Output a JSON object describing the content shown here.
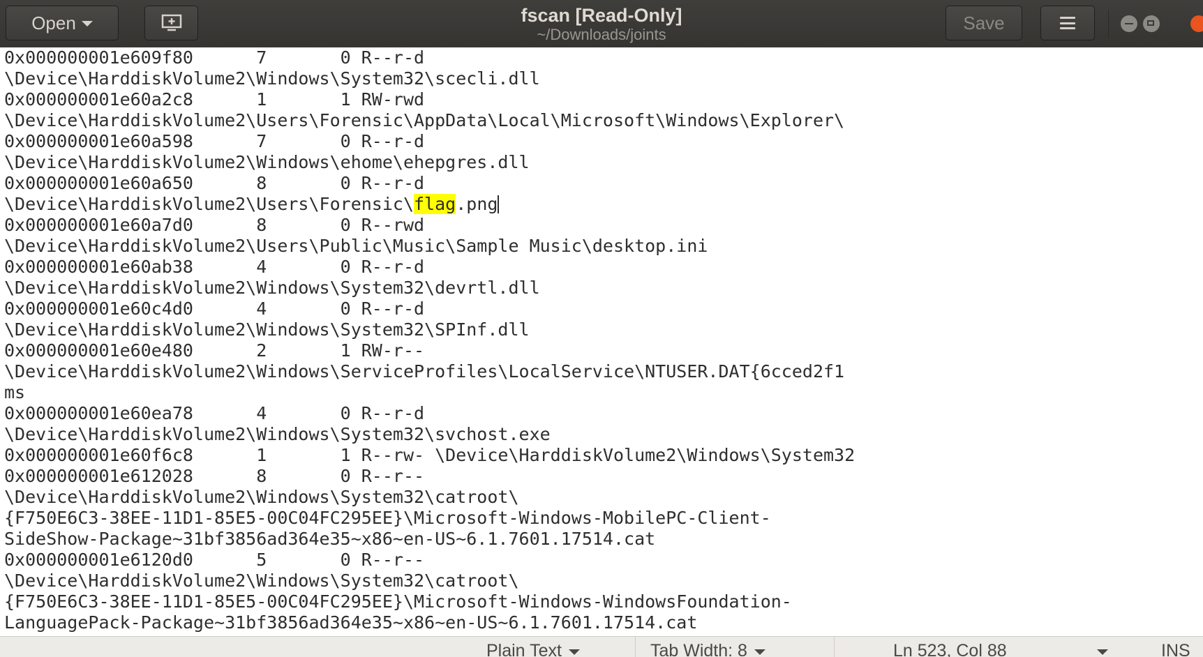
{
  "window": {
    "title": "fscan [Read-Only]",
    "subtitle": "~/Downloads/joints",
    "open_label": "Open",
    "save_label": "Save"
  },
  "editor": {
    "lines_before": [
      "0x000000001e609f80      7       0 R--r-d",
      "\\Device\\HarddiskVolume2\\Windows\\System32\\scecli.dll",
      "0x000000001e60a2c8      1       1 RW-rwd",
      "\\Device\\HarddiskVolume2\\Users\\Forensic\\AppData\\Local\\Microsoft\\Windows\\Explorer\\",
      "0x000000001e60a598      7       0 R--r-d",
      "\\Device\\HarddiskVolume2\\Windows\\ehome\\ehepgres.dll",
      "0x000000001e60a650      8       0 R--r-d"
    ],
    "match_line": {
      "prefix": "\\Device\\HarddiskVolume2\\Users\\Forensic\\",
      "match": "flag",
      "suffix": ".png"
    },
    "lines_after": [
      "0x000000001e60a7d0      8       0 R--rwd",
      "\\Device\\HarddiskVolume2\\Users\\Public\\Music\\Sample Music\\desktop.ini",
      "0x000000001e60ab38      4       0 R--r-d",
      "\\Device\\HarddiskVolume2\\Windows\\System32\\devrtl.dll",
      "0x000000001e60c4d0      4       0 R--r-d",
      "\\Device\\HarddiskVolume2\\Windows\\System32\\SPInf.dll",
      "0x000000001e60e480      2       1 RW-r--",
      "\\Device\\HarddiskVolume2\\Windows\\ServiceProfiles\\LocalService\\NTUSER.DAT{6cced2f1",
      "ms",
      "0x000000001e60ea78      4       0 R--r-d",
      "\\Device\\HarddiskVolume2\\Windows\\System32\\svchost.exe",
      "0x000000001e60f6c8      1       1 R--rw- \\Device\\HarddiskVolume2\\Windows\\System32",
      "0x000000001e612028      8       0 R--r--",
      "\\Device\\HarddiskVolume2\\Windows\\System32\\catroot\\",
      "{F750E6C3-38EE-11D1-85E5-00C04FC295EE}\\Microsoft-Windows-MobilePC-Client-",
      "SideShow-Package~31bf3856ad364e35~x86~en-US~6.1.7601.17514.cat",
      "0x000000001e6120d0      5       0 R--r--",
      "\\Device\\HarddiskVolume2\\Windows\\System32\\catroot\\",
      "{F750E6C3-38EE-11D1-85E5-00C04FC295EE}\\Microsoft-Windows-WindowsFoundation-",
      "LanguagePack-Package~31bf3856ad364e35~x86~en-US~6.1.7601.17514.cat"
    ]
  },
  "statusbar": {
    "language": "Plain Text",
    "tab_width": "Tab Width: 8",
    "position": "Ln 523, Col 88",
    "mode": "INS"
  },
  "icons": {
    "new_window": "new-window-icon",
    "menu": "hamburger-menu-icon",
    "minimize": "minimize-icon",
    "maximize": "maximize-icon",
    "close": "close-icon"
  },
  "colors": {
    "titlebar": "#3c3b37",
    "highlight": "#ffff00",
    "close_button": "#e9541f"
  }
}
